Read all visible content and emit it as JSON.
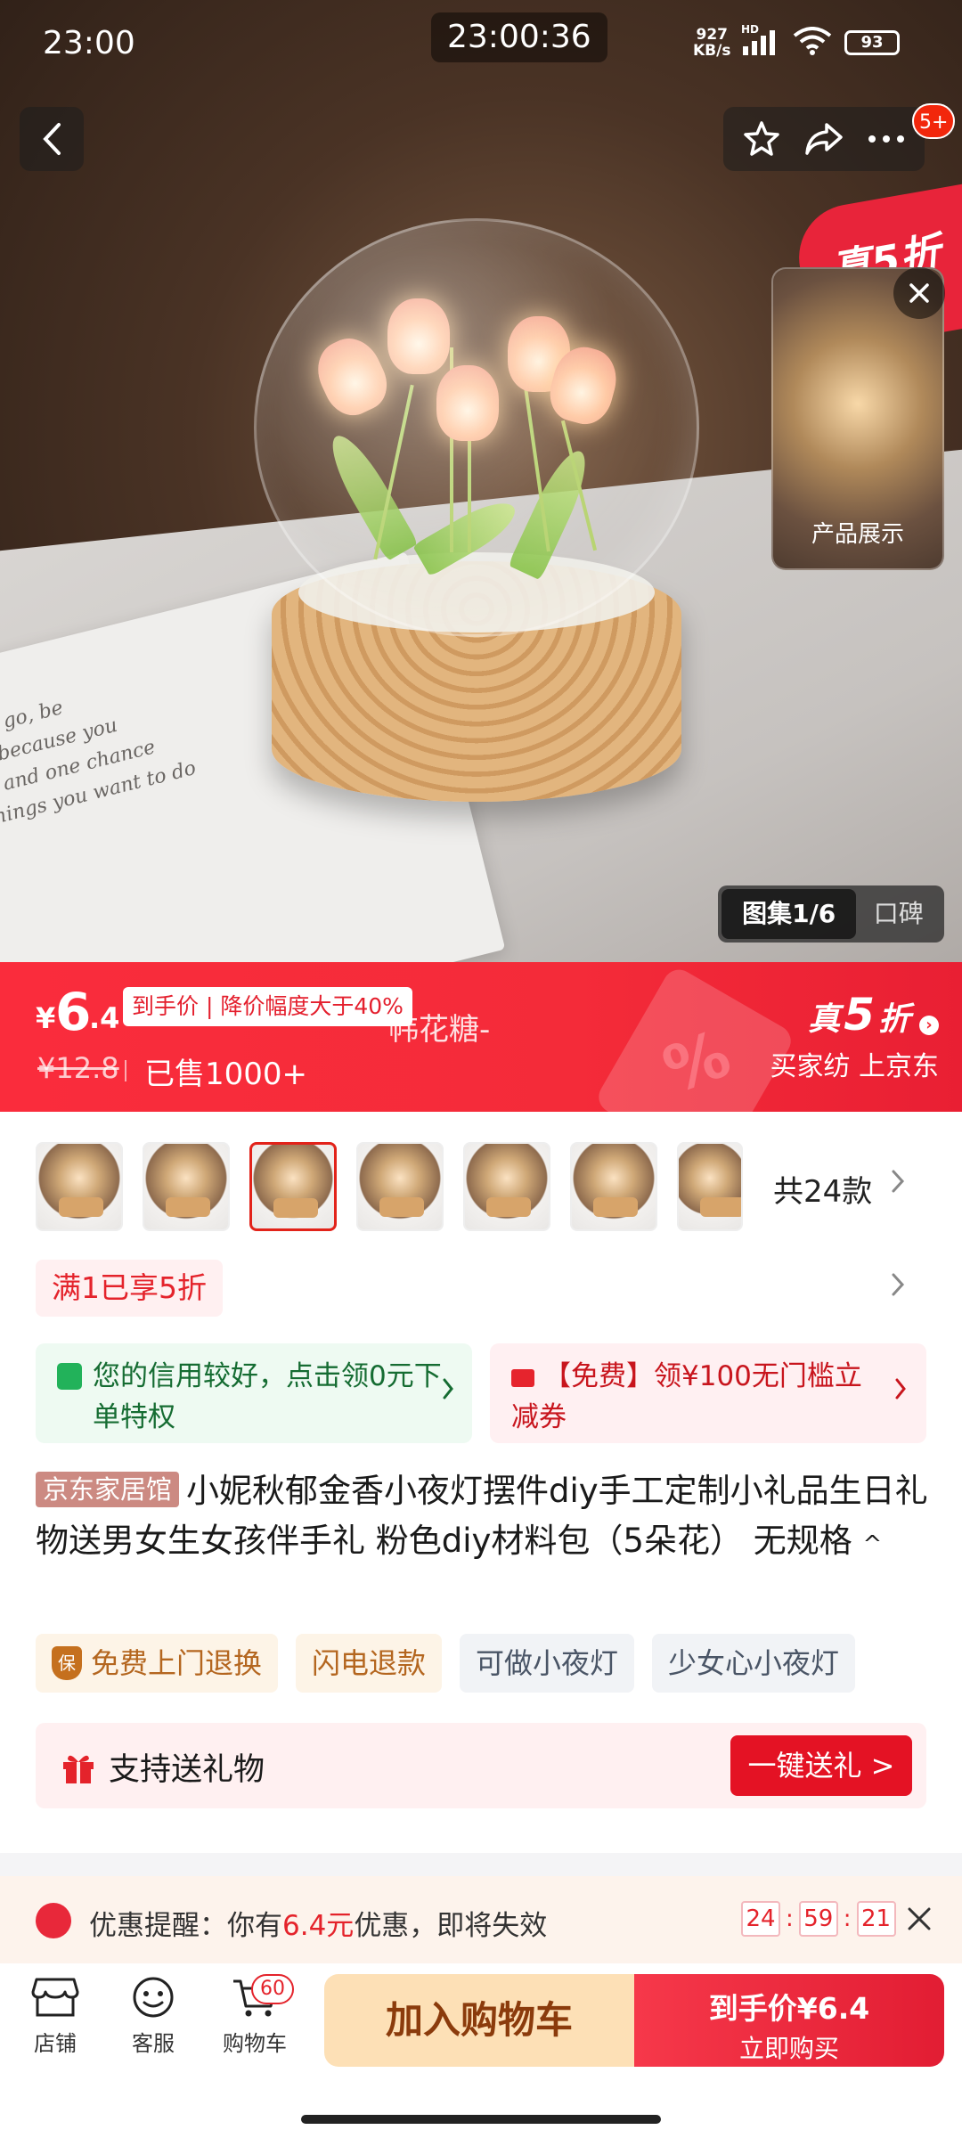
{
  "status_bar": {
    "time": "23:00",
    "clock_center": "23:00:36",
    "net_speed_value": "927",
    "net_speed_unit": "KB/s",
    "network_label": "HD",
    "battery": "93"
  },
  "hero": {
    "notification_badge": "5+",
    "promo_corner": "真5折",
    "video_label": "产品展示",
    "gallery_tabs": [
      "图集1/6",
      "口碑"
    ],
    "book_text": [
      "t to go, be",
      "ry because you",
      "fe and one chance",
      "things you want to do"
    ]
  },
  "price_banner": {
    "currency": "¥",
    "price_int": "6",
    "price_dec": ".4",
    "price_tag": "到手价 | 降价幅度大于40%",
    "ghost_text": "帏花糖-",
    "original_price": "¥12.8",
    "sold": "已售1000+",
    "discount_prefix": "真",
    "discount_num": "5",
    "discount_suffix": "折",
    "discount_sub": "买家纺 上京东"
  },
  "variants": {
    "count_label": "共24款",
    "selected_index": 2
  },
  "promo_line": "满1已享5折",
  "credit_card": {
    "text": "您的信用较好，点击领0元下单特权"
  },
  "coupon_card": {
    "text": "【免费】领¥100无门槛立减券"
  },
  "product": {
    "store_tag": "京东家居馆",
    "title": "小妮秋郁金香小夜灯摆件diy手工定制小礼品生日礼物送男女生女孩伴手礼 粉色diy材料包（5朵花） 无规格",
    "caret": "^"
  },
  "service_tags": [
    "免费上门退换",
    "闪电退款",
    "可做小夜灯",
    "少女心小夜灯"
  ],
  "shield_char": "保",
  "gift": {
    "label": "支持送礼物",
    "button": "一键送礼 >"
  },
  "reminder": {
    "prefix": "优惠提醒：你有",
    "amount": "6.4元",
    "suffix": "优惠，即将失效",
    "countdown": [
      "24",
      "59",
      "21"
    ],
    "separator": ":"
  },
  "bottom_bar": {
    "store": "店铺",
    "service": "客服",
    "cart": "购物车",
    "cart_count": "60",
    "add_to_cart": "加入购物车",
    "buy_line1": "到手价¥6.4",
    "buy_line2": "立即购买"
  },
  "colors": {
    "accent_red": "#f42b39",
    "button_red": "#e41224",
    "add_cart_bg": "#fde0b6"
  }
}
